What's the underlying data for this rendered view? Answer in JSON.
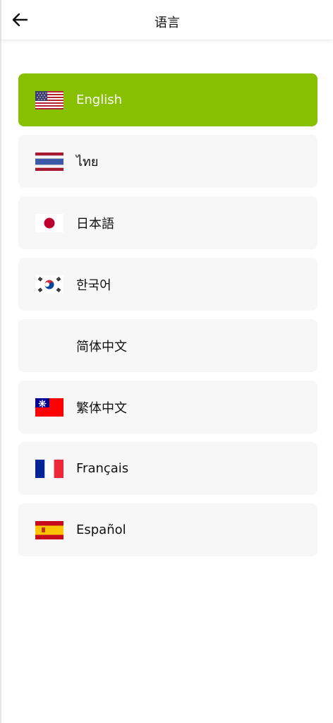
{
  "header": {
    "title": "语言",
    "back_icon": "arrow-left-icon"
  },
  "theme": {
    "accent": "#86c000"
  },
  "languages": [
    {
      "label": "English",
      "flag": "us-flag-icon",
      "selected": true
    },
    {
      "label": "ไทย",
      "flag": "thailand-flag-icon",
      "selected": false
    },
    {
      "label": "日本語",
      "flag": "japan-flag-icon",
      "selected": false
    },
    {
      "label": "한국어",
      "flag": "korea-flag-icon",
      "selected": false
    },
    {
      "label": "简体中文",
      "flag": "",
      "selected": false
    },
    {
      "label": "繁体中文",
      "flag": "taiwan-flag-icon",
      "selected": false
    },
    {
      "label": "Français",
      "flag": "france-flag-icon",
      "selected": false
    },
    {
      "label": "Español",
      "flag": "spain-flag-icon",
      "selected": false
    }
  ]
}
